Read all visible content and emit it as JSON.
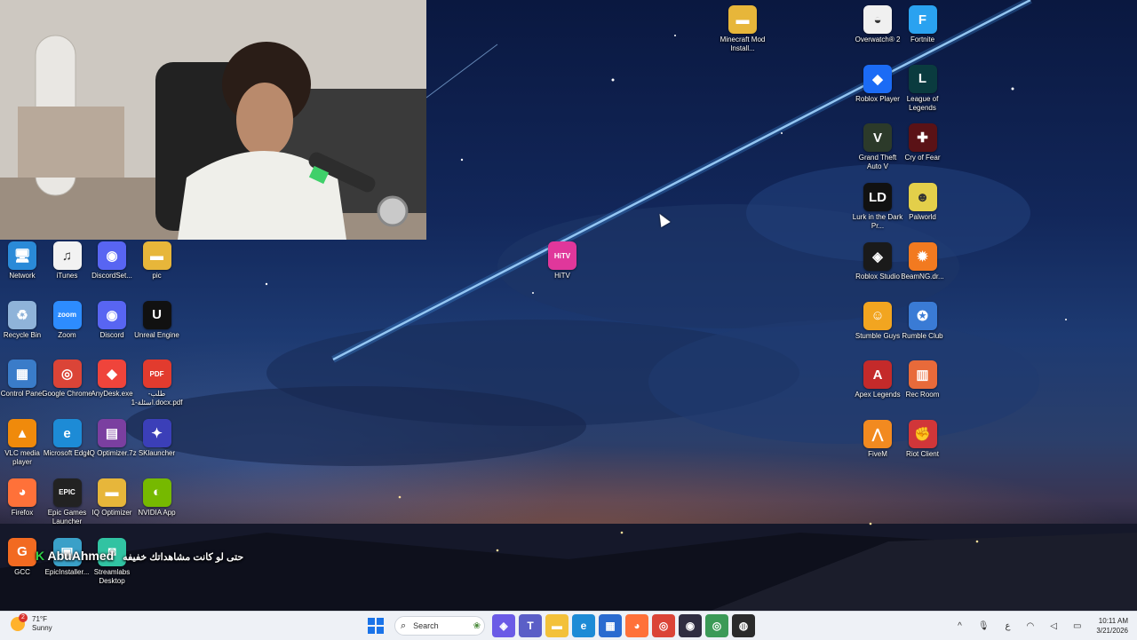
{
  "desktop_icons_left": [
    {
      "label": "Network",
      "icon": "network-icon",
      "color": "#2a8ad8",
      "glyph": "🖥",
      "col": 0,
      "row": 0
    },
    {
      "label": "iTunes",
      "icon": "itunes-icon",
      "color": "#f2f2f2",
      "glyph": "♫",
      "col": 1,
      "row": 0
    },
    {
      "label": "DiscordSet...",
      "icon": "discord-icon",
      "color": "#5865f2",
      "glyph": "◉",
      "col": 2,
      "row": 0
    },
    {
      "label": "pic",
      "icon": "folder-icon",
      "color": "#e7b63a",
      "glyph": "▬",
      "col": 3,
      "row": 0
    },
    {
      "label": "Recycle Bin",
      "icon": "recycle-bin-icon",
      "color": "#8fb3d9",
      "glyph": "♻",
      "col": 0,
      "row": 1
    },
    {
      "label": "Zoom",
      "icon": "zoom-icon",
      "color": "#2d8cff",
      "glyph": "zoom",
      "col": 1,
      "row": 1
    },
    {
      "label": "Discord",
      "icon": "discord-icon",
      "color": "#5865f2",
      "glyph": "◉",
      "col": 2,
      "row": 1
    },
    {
      "label": "Unreal Engine",
      "icon": "unreal-engine-icon",
      "color": "#111111",
      "glyph": "U",
      "col": 3,
      "row": 1
    },
    {
      "label": "Control Panel",
      "icon": "control-panel-icon",
      "color": "#3a7cc9",
      "glyph": "▦",
      "col": 0,
      "row": 2
    },
    {
      "label": "Google Chrome",
      "icon": "chrome-icon",
      "color": "#db4437",
      "glyph": "◎",
      "col": 1,
      "row": 2
    },
    {
      "label": "AnyDesk.exe",
      "icon": "anydesk-icon",
      "color": "#ef443b",
      "glyph": "◆",
      "col": 2,
      "row": 2
    },
    {
      "label": "طلب-اسئلة-1.docx.pdf",
      "icon": "pdf-icon",
      "color": "#e23b2e",
      "glyph": "PDF",
      "col": 3,
      "row": 2
    },
    {
      "label": "VLC media player",
      "icon": "vlc-icon",
      "color": "#f08a0b",
      "glyph": "▲",
      "col": 0,
      "row": 3
    },
    {
      "label": "Microsoft Edge",
      "icon": "edge-icon",
      "color": "#1d8bd6",
      "glyph": "e",
      "col": 1,
      "row": 3
    },
    {
      "label": "IQ Optimizer.7z",
      "icon": "archive-icon",
      "color": "#7b3fa0",
      "glyph": "▤",
      "col": 2,
      "row": 3
    },
    {
      "label": "SKlauncher",
      "icon": "sklauncher-icon",
      "color": "#3b3fb8",
      "glyph": "✦",
      "col": 3,
      "row": 3
    },
    {
      "label": "Firefox",
      "icon": "firefox-icon",
      "color": "#ff7139",
      "glyph": "◕",
      "col": 0,
      "row": 4
    },
    {
      "label": "Epic Games Launcher",
      "icon": "epic-games-icon",
      "color": "#222222",
      "glyph": "EPIC",
      "col": 1,
      "row": 4
    },
    {
      "label": "IQ Optimizer",
      "icon": "folder-icon",
      "color": "#e7b63a",
      "glyph": "▬",
      "col": 2,
      "row": 4
    },
    {
      "label": "NVIDIA App",
      "icon": "nvidia-icon",
      "color": "#76b900",
      "glyph": "◐",
      "col": 3,
      "row": 4
    },
    {
      "label": "GCC",
      "icon": "gcc-icon",
      "color": "#f26a21",
      "glyph": "G",
      "col": 0,
      "row": 5
    },
    {
      "label": "EpicInstaller...",
      "icon": "installer-icon",
      "color": "#3aa0c8",
      "glyph": "▣",
      "col": 1,
      "row": 5
    },
    {
      "label": "Streamlabs Desktop",
      "icon": "streamlabs-icon",
      "color": "#31c3a2",
      "glyph": "◙",
      "col": 2,
      "row": 5
    }
  ],
  "desktop_icons_mid": [
    {
      "label": "HiTV",
      "icon": "hitv-icon",
      "color": "#e0379b",
      "glyph": "HiTV"
    },
    {
      "label": "Minecraft Mod Install...",
      "icon": "folder-icon",
      "color": "#e7b63a",
      "glyph": "▬"
    }
  ],
  "desktop_icons_right": [
    {
      "label": "Overwatch® 2",
      "icon": "overwatch-icon",
      "color": "#f0f0f0",
      "glyph": "◒",
      "col": 0,
      "row": 0
    },
    {
      "label": "Fortnite",
      "icon": "fortnite-icon",
      "color": "#2aa2f0",
      "glyph": "F",
      "col": 1,
      "row": 0
    },
    {
      "label": "Roblox Player",
      "icon": "roblox-icon",
      "color": "#1b6bf5",
      "glyph": "◆",
      "col": 0,
      "row": 1
    },
    {
      "label": "League of Legends",
      "icon": "league-of-legends-icon",
      "color": "#0a3b3f",
      "glyph": "L",
      "col": 1,
      "row": 1
    },
    {
      "label": "Grand Theft Auto V",
      "icon": "gta-icon",
      "color": "#2c3a2a",
      "glyph": "V",
      "col": 0,
      "row": 2
    },
    {
      "label": "Cry of Fear",
      "icon": "cry-of-fear-icon",
      "color": "#5a1216",
      "glyph": "✚",
      "col": 1,
      "row": 2
    },
    {
      "label": "Lurk in the Dark Pr...",
      "icon": "lurk-in-the-dark-icon",
      "color": "#111111",
      "glyph": "LD",
      "col": 0,
      "row": 3
    },
    {
      "label": "Palworld",
      "icon": "palworld-icon",
      "color": "#e3cf4a",
      "glyph": "☻",
      "col": 1,
      "row": 3
    },
    {
      "label": "Roblox Studio",
      "icon": "roblox-studio-icon",
      "color": "#1a1a1a",
      "glyph": "◈",
      "col": 0,
      "row": 4
    },
    {
      "label": "BeamNG.dr...",
      "icon": "beamng-icon",
      "color": "#f27a20",
      "glyph": "✹",
      "col": 1,
      "row": 4
    },
    {
      "label": "Stumble Guys",
      "icon": "stumble-guys-icon",
      "color": "#f2a520",
      "glyph": "☺",
      "col": 0,
      "row": 5
    },
    {
      "label": "Rumble Club",
      "icon": "rumble-club-icon",
      "color": "#3a7bd5",
      "glyph": "✪",
      "col": 1,
      "row": 5
    },
    {
      "label": "Apex Legends",
      "icon": "apex-legends-icon",
      "color": "#c42a2a",
      "glyph": "A",
      "col": 0,
      "row": 6
    },
    {
      "label": "Rec Room",
      "icon": "rec-room-icon",
      "color": "#e86a3a",
      "glyph": "▥",
      "col": 1,
      "row": 6
    },
    {
      "label": "FiveM",
      "icon": "fivem-icon",
      "color": "#f28a20",
      "glyph": "⋀",
      "col": 0,
      "row": 7
    },
    {
      "label": "Riot Client",
      "icon": "riot-client-icon",
      "color": "#d13639",
      "glyph": "✊",
      "col": 1,
      "row": 7
    }
  ],
  "overlay": {
    "k_letter": "K",
    "name": "AbuAhmed",
    "arabic": "حتى لو كانت مشاهداتك خفيفه"
  },
  "taskbar": {
    "weather_temp": "71°F",
    "weather_desc": "Sunny",
    "weather_badge": "2",
    "search_placeholder": "Search",
    "time": "10:11 AM",
    "date": "3/21/2026",
    "apps": [
      {
        "name": "copilot-icon",
        "color": "#6b5be6",
        "glyph": "◈"
      },
      {
        "name": "teams-icon",
        "color": "#5b5fc7",
        "glyph": "T"
      },
      {
        "name": "file-explorer-icon",
        "color": "#f3c13a",
        "glyph": "▬"
      },
      {
        "name": "edge-icon",
        "color": "#1d8bd6",
        "glyph": "e"
      },
      {
        "name": "store-icon",
        "color": "#2a6bd0",
        "glyph": "▦"
      },
      {
        "name": "firefox-icon",
        "color": "#ff7139",
        "glyph": "◕"
      },
      {
        "name": "chrome-icon",
        "color": "#db4437",
        "glyph": "◎"
      },
      {
        "name": "obs-icon",
        "color": "#302e41",
        "glyph": "◉"
      },
      {
        "name": "chrome-profile-icon",
        "color": "#3b9a57",
        "glyph": "◎"
      },
      {
        "name": "davinci-icon",
        "color": "#2b2b2b",
        "glyph": "◍"
      }
    ]
  }
}
